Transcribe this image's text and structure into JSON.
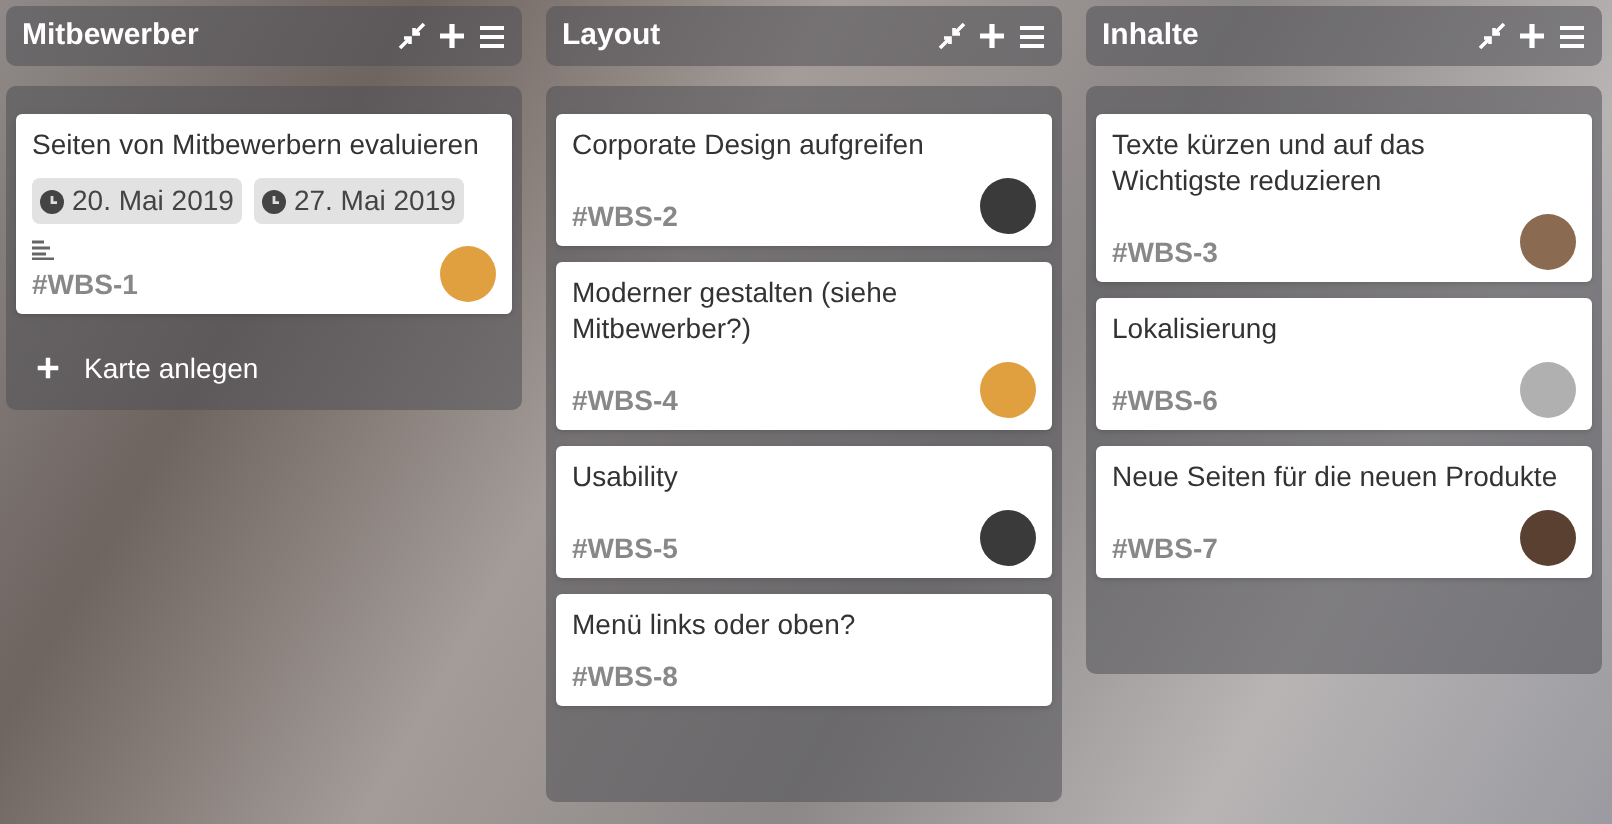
{
  "columns": [
    {
      "title": "Mitbewerber",
      "add_card": "Karte anlegen",
      "cards": [
        {
          "title": "Seiten von Mitbewerbern evaluieren",
          "dates": [
            "20. Mai 2019",
            "27. Mai 2019"
          ],
          "has_description": true,
          "id": "#WBS-1",
          "color": "#e0a040"
        }
      ]
    },
    {
      "title": "Layout",
      "cards": [
        {
          "title": "Corporate Design aufgreifen",
          "has_description": false,
          "id": "#WBS-2",
          "color": "#3a3a3a"
        },
        {
          "title": "Moderner gestalten (siehe Mitbewerber?)",
          "has_description": false,
          "id": "#WBS-4",
          "color": "#e0a040"
        },
        {
          "title": "Usability",
          "has_description": false,
          "id": "#WBS-5",
          "color": "#3a3a3a"
        },
        {
          "title": "Menü links oder oben?",
          "has_description": false,
          "id": "#WBS-8"
        }
      ]
    },
    {
      "title": "Inhalte",
      "cards": [
        {
          "title": "Texte kürzen und auf das Wichtigste reduzieren",
          "has_description": false,
          "id": "#WBS-3",
          "color": "#8a6a50"
        },
        {
          "title": "Lokalisierung",
          "has_description": false,
          "id": "#WBS-6",
          "color": "#b0b0b0"
        },
        {
          "title": "Neue Seiten für die neuen Produkte",
          "has_description": false,
          "id": "#WBS-7",
          "color": "#5a4030"
        }
      ]
    }
  ]
}
